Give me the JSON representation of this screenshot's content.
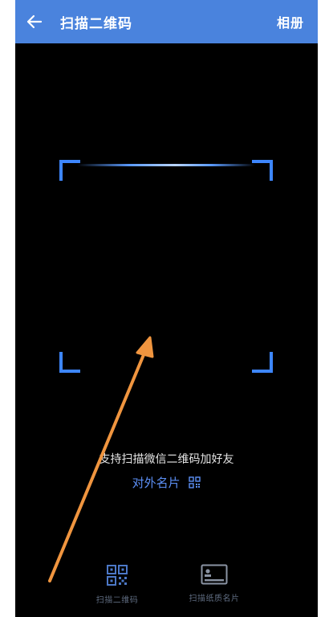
{
  "header": {
    "title": "扫描二维码",
    "album_label": "相册"
  },
  "scanner": {
    "hint": "支持扫描微信二维码加好友",
    "business_card_label": "对外名片"
  },
  "bottom_tabs": [
    {
      "label": "扫描二维码",
      "icon": "qr-code-icon",
      "active": true
    },
    {
      "label": "扫描纸质名片",
      "icon": "card-icon",
      "active": false
    }
  ],
  "colors": {
    "header_bg": "#4a83dd",
    "frame_accent": "#3d86ff",
    "link_color": "#5c8ff5",
    "annotation_arrow": "#f0953f"
  }
}
